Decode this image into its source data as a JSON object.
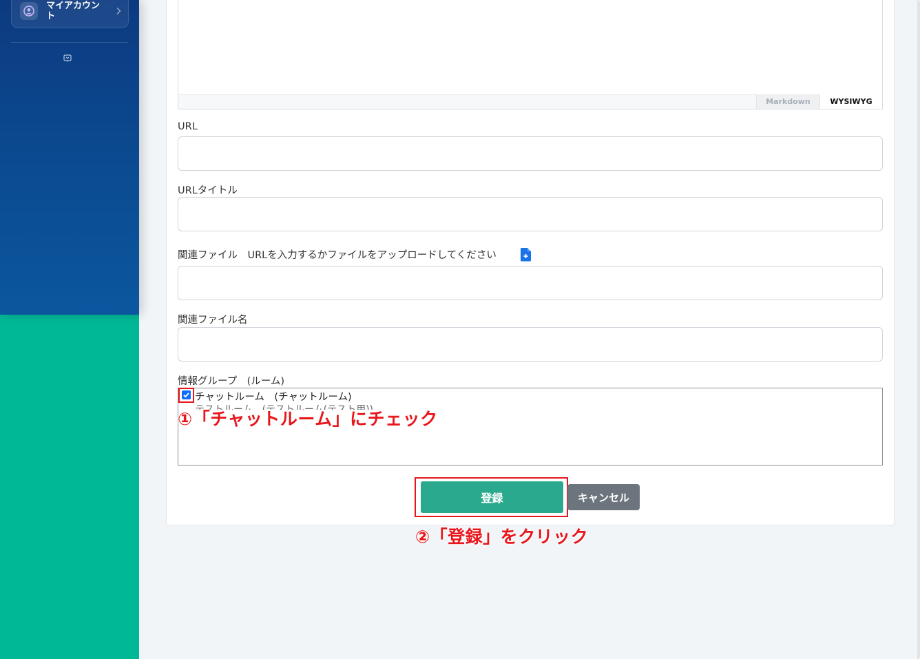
{
  "sidebar": {
    "account_label": "マイアカウント",
    "avatar_icon": "user-circle-icon",
    "chevron_icon": "chevron-right-icon",
    "collapse_icon": "collapse-sidebar-icon",
    "colors": {
      "top": "#0b4a90",
      "bottom": "#00b896"
    }
  },
  "editor": {
    "mode_tabs": [
      "Markdown",
      "WYSIWYG"
    ],
    "active_tab": "WYSIWYG"
  },
  "form": {
    "url": {
      "label": "URL",
      "value": ""
    },
    "url_title": {
      "label": "URLタイトル",
      "value": ""
    },
    "related_file": {
      "label": "関連ファイル　URLを入力するかファイルをアップロードしてください",
      "value": "",
      "upload_icon": "file-upload-icon"
    },
    "related_file_name": {
      "label": "関連ファイル名",
      "value": ""
    },
    "info_group": {
      "label": "情報グループ　(ルーム)",
      "items": [
        {
          "label": "チャットルーム　(チャットルーム)",
          "checked": true
        },
        {
          "label": "テストルーム　(テストルーム(テスト用))",
          "checked": false
        }
      ]
    }
  },
  "buttons": {
    "submit": "登録",
    "cancel": "キャンセル",
    "submit_color": "#2aa98e",
    "cancel_color": "#6c757d"
  },
  "annotations": {
    "step1": "①「チャットルーム」にチェック",
    "step2": "②「登録」をクリック",
    "color": "#e8161b"
  }
}
